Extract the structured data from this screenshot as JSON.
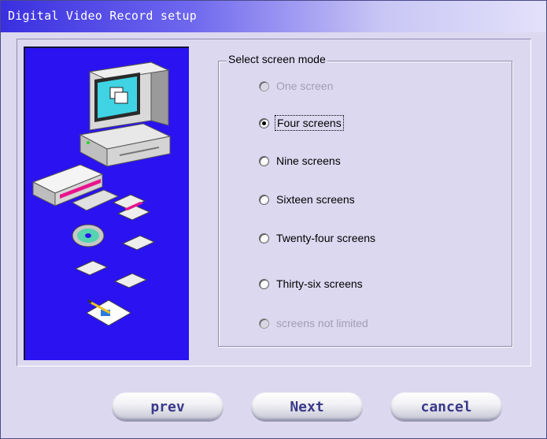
{
  "window": {
    "title": "Digital Video Record setup"
  },
  "group": {
    "legend": "Select screen mode",
    "options": [
      {
        "label": "One screen",
        "enabled": false,
        "selected": false
      },
      {
        "label": "Four screens",
        "enabled": true,
        "selected": true
      },
      {
        "label": "Nine screens",
        "enabled": true,
        "selected": false
      },
      {
        "label": "Sixteen screens",
        "enabled": true,
        "selected": false
      },
      {
        "label": "Twenty-four screens",
        "enabled": true,
        "selected": false
      },
      {
        "label": "Thirty-six screens",
        "enabled": true,
        "selected": false
      },
      {
        "label": "screens not limited",
        "enabled": false,
        "selected": false
      }
    ]
  },
  "buttons": {
    "prev": "prev",
    "next": "Next",
    "cancel": "cancel"
  },
  "colors": {
    "title_gradient_start": "#3a2fe0",
    "illustration_bg": "#2a13f0",
    "dialog_bg": "#dcd8f0",
    "button_text": "#3a3a8a"
  },
  "icons": [
    "computer-icon",
    "disk-drive-icon",
    "floppy-disk-icon",
    "cd-icon",
    "document-pen-icon"
  ]
}
